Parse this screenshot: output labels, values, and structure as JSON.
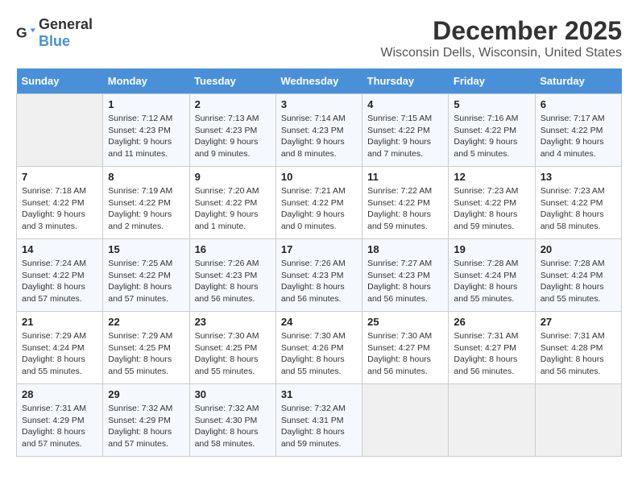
{
  "logo": {
    "general": "General",
    "blue": "Blue"
  },
  "title": "December 2025",
  "subtitle": "Wisconsin Dells, Wisconsin, United States",
  "days_of_week": [
    "Sunday",
    "Monday",
    "Tuesday",
    "Wednesday",
    "Thursday",
    "Friday",
    "Saturday"
  ],
  "weeks": [
    [
      {
        "day": "",
        "empty": true
      },
      {
        "day": "1",
        "sunrise": "7:12 AM",
        "sunset": "4:23 PM",
        "daylight": "9 hours and 11 minutes."
      },
      {
        "day": "2",
        "sunrise": "7:13 AM",
        "sunset": "4:23 PM",
        "daylight": "9 hours and 9 minutes."
      },
      {
        "day": "3",
        "sunrise": "7:14 AM",
        "sunset": "4:23 PM",
        "daylight": "9 hours and 8 minutes."
      },
      {
        "day": "4",
        "sunrise": "7:15 AM",
        "sunset": "4:22 PM",
        "daylight": "9 hours and 7 minutes."
      },
      {
        "day": "5",
        "sunrise": "7:16 AM",
        "sunset": "4:22 PM",
        "daylight": "9 hours and 5 minutes."
      },
      {
        "day": "6",
        "sunrise": "7:17 AM",
        "sunset": "4:22 PM",
        "daylight": "9 hours and 4 minutes."
      }
    ],
    [
      {
        "day": "7",
        "sunrise": "7:18 AM",
        "sunset": "4:22 PM",
        "daylight": "9 hours and 3 minutes."
      },
      {
        "day": "8",
        "sunrise": "7:19 AM",
        "sunset": "4:22 PM",
        "daylight": "9 hours and 2 minutes."
      },
      {
        "day": "9",
        "sunrise": "7:20 AM",
        "sunset": "4:22 PM",
        "daylight": "9 hours and 1 minute."
      },
      {
        "day": "10",
        "sunrise": "7:21 AM",
        "sunset": "4:22 PM",
        "daylight": "9 hours and 0 minutes."
      },
      {
        "day": "11",
        "sunrise": "7:22 AM",
        "sunset": "4:22 PM",
        "daylight": "8 hours and 59 minutes."
      },
      {
        "day": "12",
        "sunrise": "7:23 AM",
        "sunset": "4:22 PM",
        "daylight": "8 hours and 59 minutes."
      },
      {
        "day": "13",
        "sunrise": "7:23 AM",
        "sunset": "4:22 PM",
        "daylight": "8 hours and 58 minutes."
      }
    ],
    [
      {
        "day": "14",
        "sunrise": "7:24 AM",
        "sunset": "4:22 PM",
        "daylight": "8 hours and 57 minutes."
      },
      {
        "day": "15",
        "sunrise": "7:25 AM",
        "sunset": "4:22 PM",
        "daylight": "8 hours and 57 minutes."
      },
      {
        "day": "16",
        "sunrise": "7:26 AM",
        "sunset": "4:23 PM",
        "daylight": "8 hours and 56 minutes."
      },
      {
        "day": "17",
        "sunrise": "7:26 AM",
        "sunset": "4:23 PM",
        "daylight": "8 hours and 56 minutes."
      },
      {
        "day": "18",
        "sunrise": "7:27 AM",
        "sunset": "4:23 PM",
        "daylight": "8 hours and 56 minutes."
      },
      {
        "day": "19",
        "sunrise": "7:28 AM",
        "sunset": "4:24 PM",
        "daylight": "8 hours and 55 minutes."
      },
      {
        "day": "20",
        "sunrise": "7:28 AM",
        "sunset": "4:24 PM",
        "daylight": "8 hours and 55 minutes."
      }
    ],
    [
      {
        "day": "21",
        "sunrise": "7:29 AM",
        "sunset": "4:24 PM",
        "daylight": "8 hours and 55 minutes."
      },
      {
        "day": "22",
        "sunrise": "7:29 AM",
        "sunset": "4:25 PM",
        "daylight": "8 hours and 55 minutes."
      },
      {
        "day": "23",
        "sunrise": "7:30 AM",
        "sunset": "4:25 PM",
        "daylight": "8 hours and 55 minutes."
      },
      {
        "day": "24",
        "sunrise": "7:30 AM",
        "sunset": "4:26 PM",
        "daylight": "8 hours and 55 minutes."
      },
      {
        "day": "25",
        "sunrise": "7:30 AM",
        "sunset": "4:27 PM",
        "daylight": "8 hours and 56 minutes."
      },
      {
        "day": "26",
        "sunrise": "7:31 AM",
        "sunset": "4:27 PM",
        "daylight": "8 hours and 56 minutes."
      },
      {
        "day": "27",
        "sunrise": "7:31 AM",
        "sunset": "4:28 PM",
        "daylight": "8 hours and 56 minutes."
      }
    ],
    [
      {
        "day": "28",
        "sunrise": "7:31 AM",
        "sunset": "4:29 PM",
        "daylight": "8 hours and 57 minutes."
      },
      {
        "day": "29",
        "sunrise": "7:32 AM",
        "sunset": "4:29 PM",
        "daylight": "8 hours and 57 minutes."
      },
      {
        "day": "30",
        "sunrise": "7:32 AM",
        "sunset": "4:30 PM",
        "daylight": "8 hours and 58 minutes."
      },
      {
        "day": "31",
        "sunrise": "7:32 AM",
        "sunset": "4:31 PM",
        "daylight": "8 hours and 59 minutes."
      },
      {
        "day": "",
        "empty": true
      },
      {
        "day": "",
        "empty": true
      },
      {
        "day": "",
        "empty": true
      }
    ]
  ],
  "labels": {
    "sunrise": "Sunrise:",
    "sunset": "Sunset:",
    "daylight": "Daylight:"
  }
}
